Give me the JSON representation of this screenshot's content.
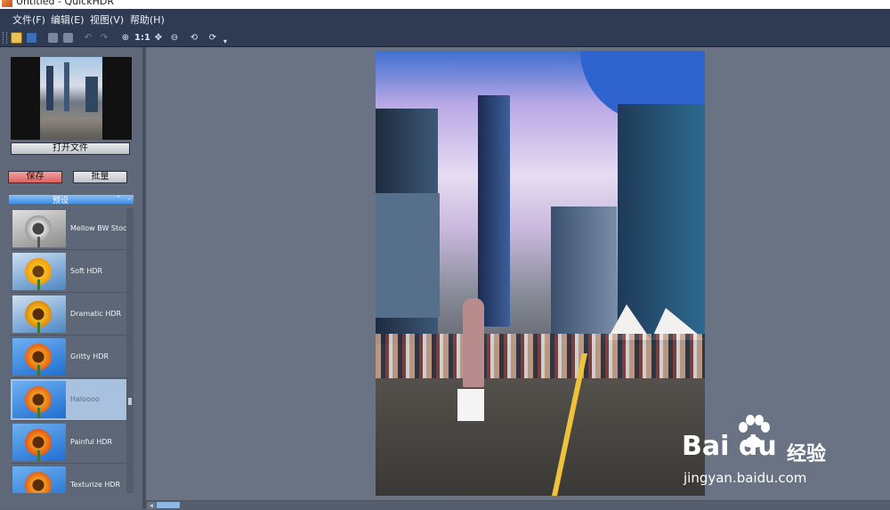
{
  "window": {
    "title": "Untitled - QuickHDR"
  },
  "menu": [
    {
      "label": "文件(F)"
    },
    {
      "label": "编辑(E)"
    },
    {
      "label": "视图(V)"
    },
    {
      "label": "帮助(H)"
    }
  ],
  "toolbar": {
    "zoom_1to1_label": "1:1",
    "overflow_label": "▾",
    "icons": [
      "open-icon",
      "save-icon",
      "copy-icon",
      "paste-icon",
      "undo-icon",
      "redo-icon",
      "zoom-in-icon",
      "zoom-1to1-icon",
      "fit-icon",
      "zoom-out-icon",
      "rotate-left-icon",
      "rotate-right-icon"
    ]
  },
  "sidebar": {
    "open_button": "打开文件",
    "save_button": "保存",
    "batch_button": "批量",
    "presets_header": "预设",
    "header_controls": [
      "˄",
      "–"
    ],
    "presets": [
      {
        "name": "Mellow BW Stoc",
        "selected": false
      },
      {
        "name": "Soft HDR",
        "selected": false
      },
      {
        "name": "Dramatic HDR",
        "selected": false
      },
      {
        "name": "Gritty HDR",
        "selected": false
      },
      {
        "name": "Haloooo",
        "selected": true
      },
      {
        "name": "Painful HDR",
        "selected": false
      },
      {
        "name": "Texturize HDR",
        "selected": false
      }
    ]
  },
  "canvas": {
    "scroll_left_arrow": "◂"
  },
  "watermark": {
    "brand": "Bai du",
    "brand_cn": "经验",
    "url": "jingyan.baidu.com"
  },
  "colors": {
    "menubar": "#2e3b52",
    "save_button": "#e07070",
    "selected_preset": "#a8c1df",
    "presets_header": "#4a94e8"
  }
}
